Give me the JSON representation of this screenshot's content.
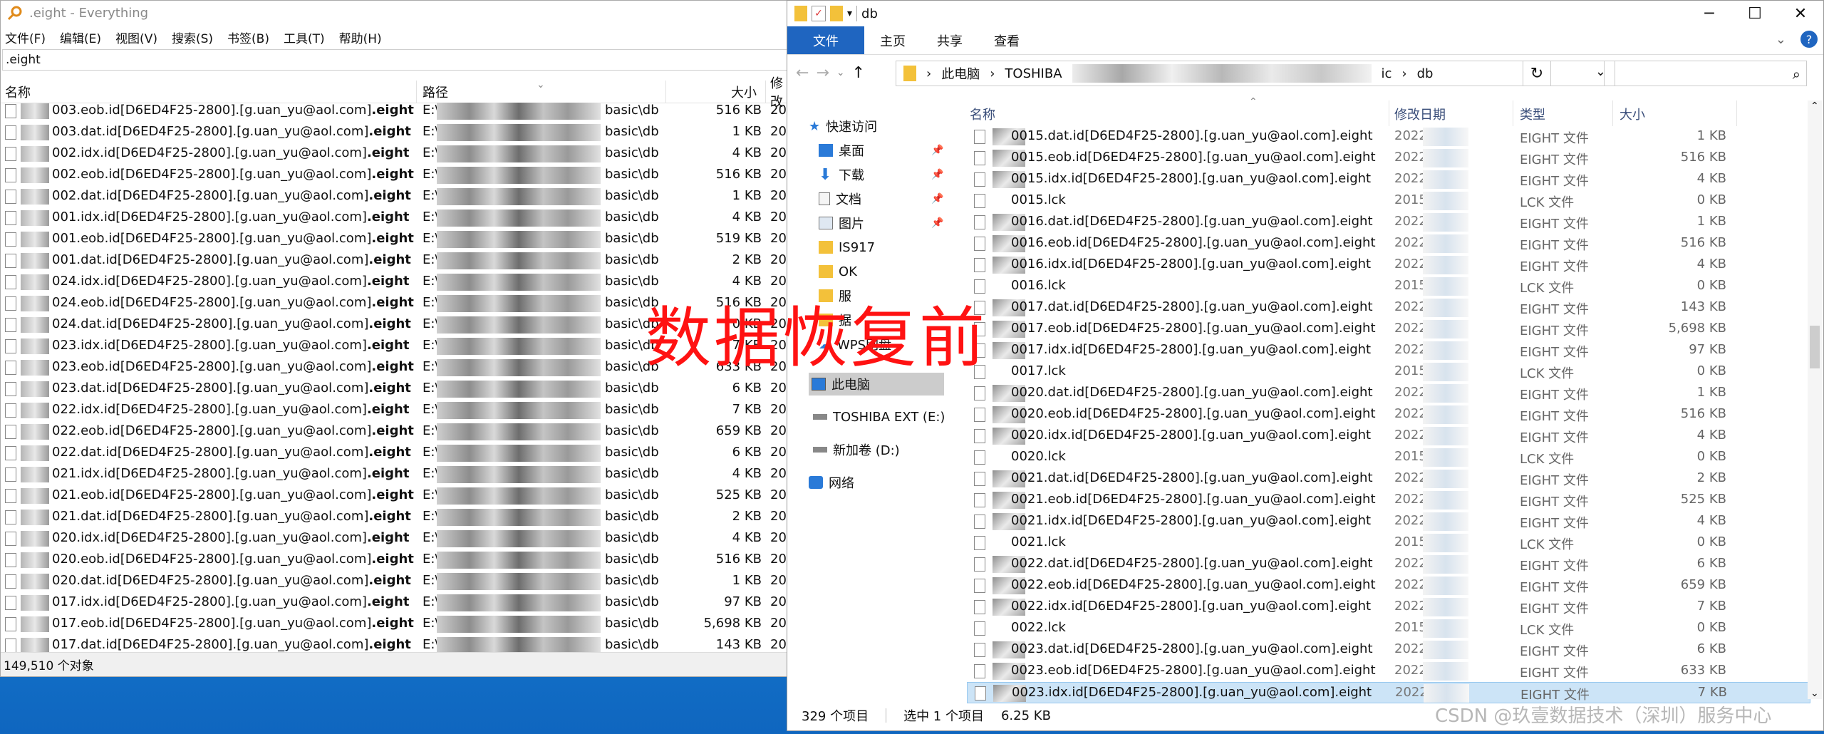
{
  "everything": {
    "title": ".eight - Everything",
    "menu": [
      "文件(F)",
      "编辑(E)",
      "视图(V)",
      "搜索(S)",
      "书签(B)",
      "工具(T)",
      "帮助(H)"
    ],
    "search_value": ".eight",
    "columns": {
      "name": "名称",
      "path": "路径",
      "size": "大小",
      "modified": "修改"
    },
    "rows": [
      {
        "name_pre": "003.eob.id[D6ED4F25-2800].[g.uan_yu@aol.com]",
        "path_prefix": "E:\\",
        "path_suffix": "basic\\db",
        "size": "516 KB",
        "date": "20"
      },
      {
        "name_pre": "003.dat.id[D6ED4F25-2800].[g.uan_yu@aol.com]",
        "path_prefix": "E:\\",
        "path_suffix": "basic\\db",
        "size": "1 KB",
        "date": "20"
      },
      {
        "name_pre": "002.idx.id[D6ED4F25-2800].[g.uan_yu@aol.com]",
        "path_prefix": "E:\\",
        "path_suffix": "basic\\db",
        "size": "4 KB",
        "date": "20"
      },
      {
        "name_pre": "002.eob.id[D6ED4F25-2800].[g.uan_yu@aol.com]",
        "path_prefix": "E:\\",
        "path_suffix": "basic\\db",
        "size": "516 KB",
        "date": "20"
      },
      {
        "name_pre": "002.dat.id[D6ED4F25-2800].[g.uan_yu@aol.com]",
        "path_prefix": "E:\\",
        "path_suffix": "basic\\db",
        "size": "1 KB",
        "date": "20"
      },
      {
        "name_pre": "001.idx.id[D6ED4F25-2800].[g.uan_yu@aol.com]",
        "path_prefix": "E:\\",
        "path_suffix": "basic\\db",
        "size": "4 KB",
        "date": "20"
      },
      {
        "name_pre": "001.eob.id[D6ED4F25-2800].[g.uan_yu@aol.com]",
        "path_prefix": "E:\\",
        "path_suffix": "basic\\db",
        "size": "519 KB",
        "date": "20"
      },
      {
        "name_pre": "001.dat.id[D6ED4F25-2800].[g.uan_yu@aol.com]",
        "path_prefix": "E:\\",
        "path_suffix": "basic\\db",
        "size": "2 KB",
        "date": "20"
      },
      {
        "name_pre": "024.idx.id[D6ED4F25-2800].[g.uan_yu@aol.com]",
        "path_prefix": "E:\\",
        "path_suffix": "basic\\db",
        "size": "4 KB",
        "date": "20"
      },
      {
        "name_pre": "024.eob.id[D6ED4F25-2800].[g.uan_yu@aol.com]",
        "path_prefix": "E:\\",
        "path_suffix": "basic\\db",
        "size": "516 KB",
        "date": "20"
      },
      {
        "name_pre": "024.dat.id[D6ED4F25-2800].[g.uan_yu@aol.com]",
        "path_prefix": "E:\\",
        "path_suffix": "basic\\db",
        "size": "0 KB",
        "date": "20"
      },
      {
        "name_pre": "023.idx.id[D6ED4F25-2800].[g.uan_yu@aol.com]",
        "path_prefix": "E:\\",
        "path_suffix": "basic\\db",
        "size": "7 KB",
        "date": "20"
      },
      {
        "name_pre": "023.eob.id[D6ED4F25-2800].[g.uan_yu@aol.com]",
        "path_prefix": "E:\\",
        "path_suffix": "basic\\db",
        "size": "633 KB",
        "date": "20"
      },
      {
        "name_pre": "023.dat.id[D6ED4F25-2800].[g.uan_yu@aol.com]",
        "path_prefix": "E:\\",
        "path_suffix": "basic\\db",
        "size": "6 KB",
        "date": "20"
      },
      {
        "name_pre": "022.idx.id[D6ED4F25-2800].[g.uan_yu@aol.com]",
        "path_prefix": "E:\\",
        "path_suffix": "basic\\db",
        "size": "7 KB",
        "date": "20"
      },
      {
        "name_pre": "022.eob.id[D6ED4F25-2800].[g.uan_yu@aol.com]",
        "path_prefix": "E:\\",
        "path_suffix": "basic\\db",
        "size": "659 KB",
        "date": "20"
      },
      {
        "name_pre": "022.dat.id[D6ED4F25-2800].[g.uan_yu@aol.com]",
        "path_prefix": "E:\\",
        "path_suffix": "basic\\db",
        "size": "6 KB",
        "date": "20"
      },
      {
        "name_pre": "021.idx.id[D6ED4F25-2800].[g.uan_yu@aol.com]",
        "path_prefix": "E:\\",
        "path_suffix": "basic\\db",
        "size": "4 KB",
        "date": "20"
      },
      {
        "name_pre": "021.eob.id[D6ED4F25-2800].[g.uan_yu@aol.com]",
        "path_prefix": "E:\\",
        "path_suffix": "basic\\db",
        "size": "525 KB",
        "date": "20"
      },
      {
        "name_pre": "021.dat.id[D6ED4F25-2800].[g.uan_yu@aol.com]",
        "path_prefix": "E:\\",
        "path_suffix": "basic\\db",
        "size": "2 KB",
        "date": "20"
      },
      {
        "name_pre": "020.idx.id[D6ED4F25-2800].[g.uan_yu@aol.com]",
        "path_prefix": "E:\\",
        "path_suffix": "basic\\db",
        "size": "4 KB",
        "date": "20"
      },
      {
        "name_pre": "020.eob.id[D6ED4F25-2800].[g.uan_yu@aol.com]",
        "path_prefix": "E:\\",
        "path_suffix": "basic\\db",
        "size": "516 KB",
        "date": "20"
      },
      {
        "name_pre": "020.dat.id[D6ED4F25-2800].[g.uan_yu@aol.com]",
        "path_prefix": "E:\\",
        "path_suffix": "basic\\db",
        "size": "1 KB",
        "date": "20"
      },
      {
        "name_pre": "017.idx.id[D6ED4F25-2800].[g.uan_yu@aol.com]",
        "path_prefix": "E:\\",
        "path_suffix": "basic\\db",
        "size": "97 KB",
        "date": "20"
      },
      {
        "name_pre": "017.eob.id[D6ED4F25-2800].[g.uan_yu@aol.com]",
        "path_prefix": "E:\\",
        "path_suffix": "basic\\db",
        "size": "5,698 KB",
        "date": "20"
      },
      {
        "name_pre": "017.dat.id[D6ED4F25-2800].[g.uan_yu@aol.com]",
        "path_prefix": "E:\\",
        "path_suffix": "basic\\db",
        "size": "143 KB",
        "date": "20"
      }
    ],
    "ext_bold": ".eight",
    "status": "149,510 个对象"
  },
  "explorer": {
    "title": "db",
    "ribbon_tabs": [
      "文件",
      "主页",
      "共享",
      "查看"
    ],
    "breadcrumb": {
      "pc": "此电脑",
      "drive": "TOSHIBA",
      "ic": "ic",
      "folder": "db"
    },
    "nav": {
      "quick": "快速访问",
      "desktop": "桌面",
      "downloads": "下载",
      "docs": "文档",
      "pictures": "图片",
      "is917": "IS917",
      "ok": "OK",
      "hidden1": "服",
      "hidden2": "据",
      "wps": "WPS网盘",
      "pc": "此电脑",
      "toshiba": "TOSHIBA EXT (E:)",
      "newvol": "新加卷 (D:)",
      "network": "网络"
    },
    "columns": {
      "name": "名称",
      "date": "修改日期",
      "type": "类型",
      "size": "大小"
    },
    "files": [
      {
        "name": "0015.dat.id[D6ED4F25-2800].[g.uan_yu@aol.com].eight",
        "date": "2022",
        "type": "EIGHT 文件",
        "size": "1 KB"
      },
      {
        "name": "0015.eob.id[D6ED4F25-2800].[g.uan_yu@aol.com].eight",
        "date": "2022",
        "type": "EIGHT 文件",
        "size": "516 KB"
      },
      {
        "name": "0015.idx.id[D6ED4F25-2800].[g.uan_yu@aol.com].eight",
        "date": "2022",
        "type": "EIGHT 文件",
        "size": "4 KB"
      },
      {
        "name": "0015.lck",
        "date": "2015",
        "type": "LCK 文件",
        "size": "0 KB"
      },
      {
        "name": "0016.dat.id[D6ED4F25-2800].[g.uan_yu@aol.com].eight",
        "date": "2022",
        "type": "EIGHT 文件",
        "size": "1 KB"
      },
      {
        "name": "0016.eob.id[D6ED4F25-2800].[g.uan_yu@aol.com].eight",
        "date": "2022",
        "type": "EIGHT 文件",
        "size": "516 KB"
      },
      {
        "name": "0016.idx.id[D6ED4F25-2800].[g.uan_yu@aol.com].eight",
        "date": "2022",
        "type": "EIGHT 文件",
        "size": "4 KB"
      },
      {
        "name": "0016.lck",
        "date": "2015",
        "type": "LCK 文件",
        "size": "0 KB"
      },
      {
        "name": "0017.dat.id[D6ED4F25-2800].[g.uan_yu@aol.com].eight",
        "date": "2022",
        "type": "EIGHT 文件",
        "size": "143 KB"
      },
      {
        "name": "0017.eob.id[D6ED4F25-2800].[g.uan_yu@aol.com].eight",
        "date": "2022",
        "type": "EIGHT 文件",
        "size": "5,698 KB"
      },
      {
        "name": "0017.idx.id[D6ED4F25-2800].[g.uan_yu@aol.com].eight",
        "date": "2022",
        "type": "EIGHT 文件",
        "size": "97 KB"
      },
      {
        "name": "0017.lck",
        "date": "2015",
        "type": "LCK 文件",
        "size": "0 KB"
      },
      {
        "name": "0020.dat.id[D6ED4F25-2800].[g.uan_yu@aol.com].eight",
        "date": "2022",
        "type": "EIGHT 文件",
        "size": "1 KB"
      },
      {
        "name": "0020.eob.id[D6ED4F25-2800].[g.uan_yu@aol.com].eight",
        "date": "2022",
        "type": "EIGHT 文件",
        "size": "516 KB"
      },
      {
        "name": "0020.idx.id[D6ED4F25-2800].[g.uan_yu@aol.com].eight",
        "date": "2022",
        "type": "EIGHT 文件",
        "size": "4 KB"
      },
      {
        "name": "0020.lck",
        "date": "2015",
        "type": "LCK 文件",
        "size": "0 KB"
      },
      {
        "name": "0021.dat.id[D6ED4F25-2800].[g.uan_yu@aol.com].eight",
        "date": "2022",
        "type": "EIGHT 文件",
        "size": "2 KB"
      },
      {
        "name": "0021.eob.id[D6ED4F25-2800].[g.uan_yu@aol.com].eight",
        "date": "2022",
        "type": "EIGHT 文件",
        "size": "525 KB"
      },
      {
        "name": "0021.idx.id[D6ED4F25-2800].[g.uan_yu@aol.com].eight",
        "date": "2022",
        "type": "EIGHT 文件",
        "size": "4 KB"
      },
      {
        "name": "0021.lck",
        "date": "2015",
        "type": "LCK 文件",
        "size": "0 KB"
      },
      {
        "name": "0022.dat.id[D6ED4F25-2800].[g.uan_yu@aol.com].eight",
        "date": "2022",
        "type": "EIGHT 文件",
        "size": "6 KB"
      },
      {
        "name": "0022.eob.id[D6ED4F25-2800].[g.uan_yu@aol.com].eight",
        "date": "2022",
        "type": "EIGHT 文件",
        "size": "659 KB"
      },
      {
        "name": "0022.idx.id[D6ED4F25-2800].[g.uan_yu@aol.com].eight",
        "date": "2022",
        "type": "EIGHT 文件",
        "size": "7 KB"
      },
      {
        "name": "0022.lck",
        "date": "2015",
        "type": "LCK 文件",
        "size": "0 KB"
      },
      {
        "name": "0023.dat.id[D6ED4F25-2800].[g.uan_yu@aol.com].eight",
        "date": "2022",
        "type": "EIGHT 文件",
        "size": "6 KB"
      },
      {
        "name": "0023.eob.id[D6ED4F25-2800].[g.uan_yu@aol.com].eight",
        "date": "2022",
        "type": "EIGHT 文件",
        "size": "633 KB"
      },
      {
        "name": "0023.idx.id[D6ED4F25-2800].[g.uan_yu@aol.com].eight",
        "date": "2022",
        "type": "EIGHT 文件",
        "size": "7 KB",
        "selected": true
      }
    ],
    "status_count": "329 个项目",
    "status_selected": "选中 1 个项目",
    "status_size": "6.25 KB"
  },
  "overlay_text": "数据恢复前",
  "watermark": "CSDN @玖壹数据技术（深圳）服务中心"
}
